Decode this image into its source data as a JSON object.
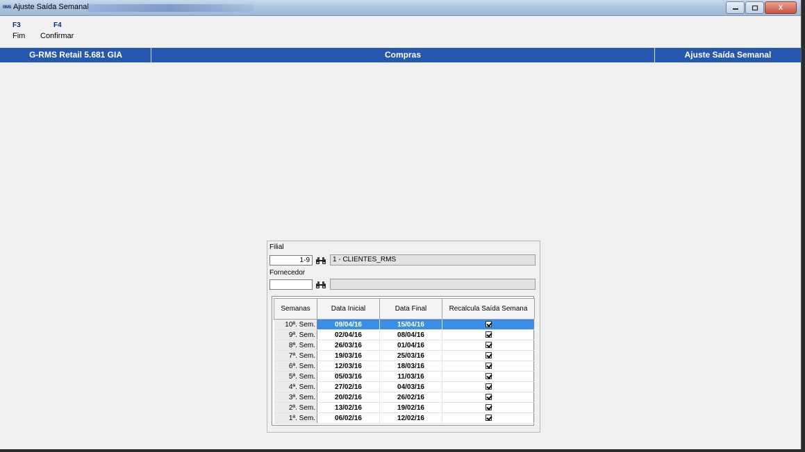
{
  "window": {
    "app_badge": "RMS",
    "title": "Ajuste Saída Semanal",
    "controls": {
      "close": "X"
    }
  },
  "fkeys": [
    {
      "key": "F3",
      "label": "Fim"
    },
    {
      "key": "F4",
      "label": "Confirmar"
    }
  ],
  "header_bar": {
    "left": "G-RMS Retail 5.681 GIA",
    "center": "Compras",
    "right": "Ajuste Saída Semanal",
    "color": "#2758b0"
  },
  "form": {
    "filial_label": "Filial",
    "filial_value": "1-9",
    "filial_name": "1 - CLIENTES_RMS",
    "fornecedor_label": "Fornecedor",
    "fornecedor_value": "",
    "fornecedor_name": "",
    "search_icon": "binoculars-icon"
  },
  "grid": {
    "columns": [
      "Semanas",
      "Data Inicial",
      "Data Final",
      "Recalcula Saída Semana"
    ],
    "selected_color": "#3b8ee8",
    "rows": [
      {
        "week": "10ª. Sem.",
        "start": "09/04/16",
        "end": "15/04/16",
        "recalc": true
      },
      {
        "week": "9ª. Sem.",
        "start": "02/04/16",
        "end": "08/04/16",
        "recalc": true
      },
      {
        "week": "8ª. Sem.",
        "start": "26/03/16",
        "end": "01/04/16",
        "recalc": true
      },
      {
        "week": "7ª. Sem.",
        "start": "19/03/16",
        "end": "25/03/16",
        "recalc": true
      },
      {
        "week": "6ª. Sem.",
        "start": "12/03/16",
        "end": "18/03/16",
        "recalc": true
      },
      {
        "week": "5ª. Sem.",
        "start": "05/03/16",
        "end": "11/03/16",
        "recalc": true
      },
      {
        "week": "4ª. Sem.",
        "start": "27/02/16",
        "end": "04/03/16",
        "recalc": true
      },
      {
        "week": "3ª. Sem.",
        "start": "20/02/16",
        "end": "26/02/16",
        "recalc": true
      },
      {
        "week": "2ª. Sem.",
        "start": "13/02/16",
        "end": "19/02/16",
        "recalc": true
      },
      {
        "week": "1ª. Sem.",
        "start": "06/02/16",
        "end": "12/02/16",
        "recalc": true
      }
    ]
  }
}
